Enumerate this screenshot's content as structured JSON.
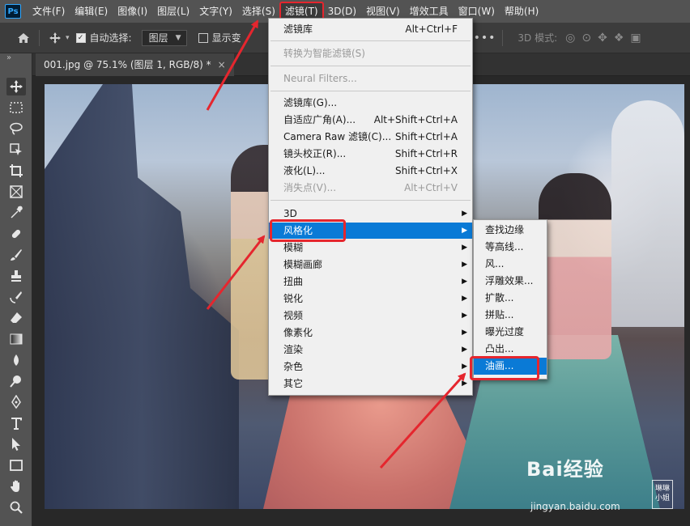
{
  "menubar": {
    "items": [
      "文件(F)",
      "编辑(E)",
      "图像(I)",
      "图层(L)",
      "文字(Y)",
      "选择(S)",
      "滤镜(T)",
      "3D(D)",
      "视图(V)",
      "增效工具",
      "窗口(W)",
      "帮助(H)"
    ],
    "open_index": 6
  },
  "options": {
    "auto_select_label": "自动选择:",
    "auto_select_checked": true,
    "layer_select_value": "图层",
    "show_transform_label": "显示变",
    "mode_3d_label": "3D 模式:"
  },
  "tab": {
    "title": "001.jpg @ 75.1% (图层 1, RGB/8) *",
    "close": "×"
  },
  "filter_menu": {
    "items": [
      {
        "label": "滤镜库",
        "shortcut": "Alt+Ctrl+F",
        "disabled": false
      },
      {
        "label": "转换为智能滤镜(S)",
        "shortcut": "",
        "disabled": true
      },
      {
        "label": "Neural Filters...",
        "shortcut": "",
        "disabled": true
      },
      {
        "label": "滤镜库(G)...",
        "shortcut": "",
        "disabled": false
      },
      {
        "label": "自适应广角(A)...",
        "shortcut": "Alt+Shift+Ctrl+A",
        "disabled": false
      },
      {
        "label": "Camera Raw 滤镜(C)...",
        "shortcut": "Shift+Ctrl+A",
        "disabled": false
      },
      {
        "label": "镜头校正(R)...",
        "shortcut": "Shift+Ctrl+R",
        "disabled": false
      },
      {
        "label": "液化(L)...",
        "shortcut": "Shift+Ctrl+X",
        "disabled": false
      },
      {
        "label": "消失点(V)...",
        "shortcut": "Alt+Ctrl+V",
        "disabled": true
      },
      {
        "label": "3D",
        "shortcut": "",
        "disabled": false
      },
      {
        "label": "风格化",
        "shortcut": "",
        "disabled": false
      },
      {
        "label": "模糊",
        "shortcut": "",
        "disabled": false
      },
      {
        "label": "模糊画廊",
        "shortcut": "",
        "disabled": false
      },
      {
        "label": "扭曲",
        "shortcut": "",
        "disabled": false
      },
      {
        "label": "锐化",
        "shortcut": "",
        "disabled": false
      },
      {
        "label": "视频",
        "shortcut": "",
        "disabled": false
      },
      {
        "label": "像素化",
        "shortcut": "",
        "disabled": false
      },
      {
        "label": "渲染",
        "shortcut": "",
        "disabled": false
      },
      {
        "label": "杂色",
        "shortcut": "",
        "disabled": false
      },
      {
        "label": "其它",
        "shortcut": "",
        "disabled": false
      }
    ],
    "highlighted": "风格化"
  },
  "stylize_submenu": {
    "items": [
      "查找边缘",
      "等高线...",
      "风...",
      "浮雕效果...",
      "扩散...",
      "拼贴...",
      "曝光过度",
      "凸出...",
      "油画..."
    ],
    "highlighted": "油画..."
  },
  "watermark": {
    "brand": "Bai经验",
    "url": "jingyan.baidu.com",
    "stamp": "琳琳小姐"
  },
  "colors": {
    "highlight": "#0a7ad6",
    "annotation": "#e5262e",
    "menubar": "#535353"
  }
}
